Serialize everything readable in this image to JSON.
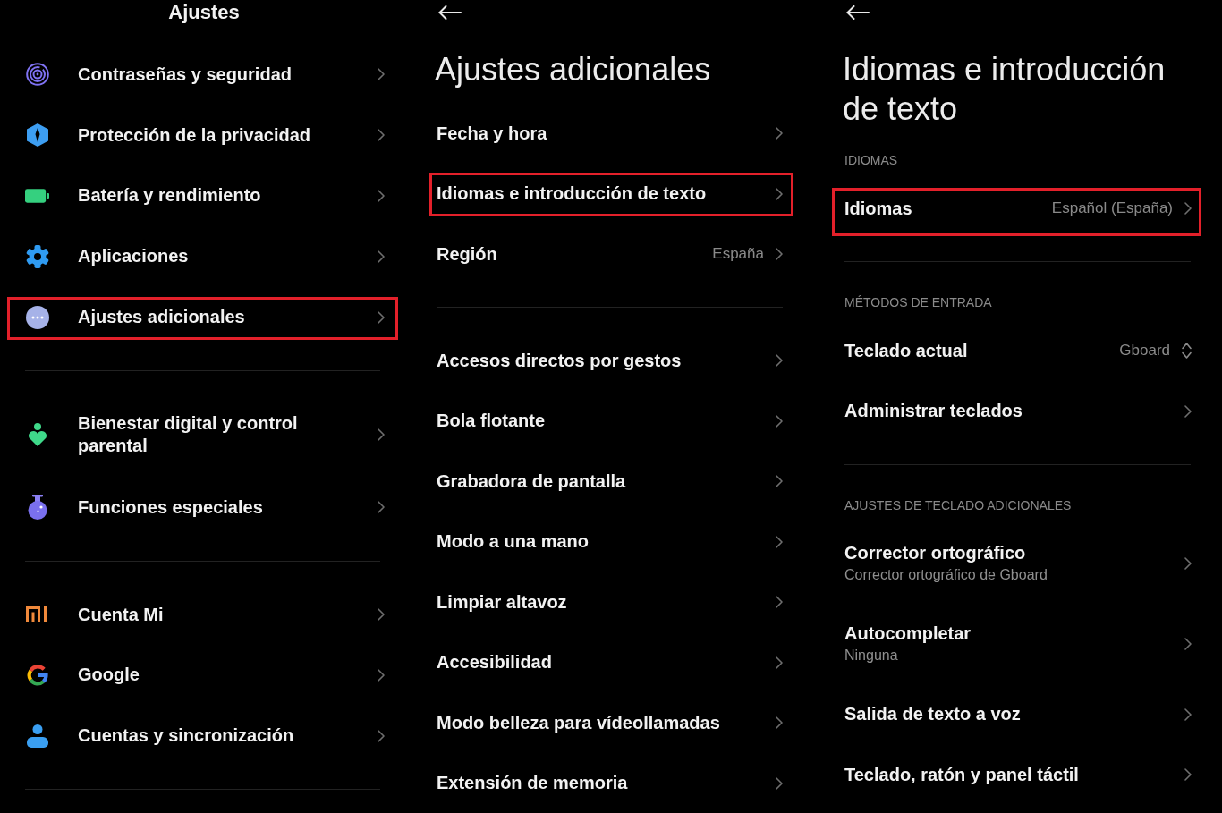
{
  "panels": [
    {
      "kind": "root",
      "title": "Ajustes",
      "groups": [
        {
          "items": [
            {
              "kind": "link",
              "label": "Contraseñas y seguridad",
              "highlighted": false
            },
            {
              "kind": "link",
              "label": "Protección de la privacidad",
              "highlighted": false
            },
            {
              "kind": "link",
              "label": "Batería y rendimiento",
              "highlighted": false
            },
            {
              "kind": "link",
              "label": "Aplicaciones",
              "highlighted": false
            },
            {
              "kind": "link",
              "label": "Ajustes adicionales",
              "highlighted": true
            }
          ]
        },
        {
          "items": [
            {
              "kind": "link",
              "label": "Bienestar digital y control parental",
              "highlighted": false
            },
            {
              "kind": "link",
              "label": "Funciones especiales",
              "highlighted": false
            }
          ]
        },
        {
          "items": [
            {
              "kind": "link",
              "label": "Cuenta Mi",
              "highlighted": false
            },
            {
              "kind": "link",
              "label": "Google",
              "highlighted": false
            },
            {
              "kind": "link",
              "label": "Cuentas y sincronización",
              "highlighted": false
            }
          ]
        }
      ]
    },
    {
      "kind": "sub",
      "title": "Ajustes adicionales",
      "groups": [
        {
          "items": [
            {
              "kind": "link",
              "label": "Fecha y hora",
              "highlighted": false
            },
            {
              "kind": "link",
              "label": "Idiomas e introducción de texto",
              "highlighted": true
            },
            {
              "kind": "link",
              "label": "Región",
              "value": "España",
              "highlighted": false
            }
          ]
        },
        {
          "items": [
            {
              "kind": "link",
              "label": "Accesos directos por gestos",
              "highlighted": false
            },
            {
              "kind": "link",
              "label": "Bola flotante",
              "highlighted": false
            },
            {
              "kind": "link",
              "label": "Grabadora de pantalla",
              "highlighted": false
            },
            {
              "kind": "link",
              "label": "Modo a una mano",
              "highlighted": false
            },
            {
              "kind": "link",
              "label": "Limpiar altavoz",
              "highlighted": false
            },
            {
              "kind": "link",
              "label": "Accesibilidad",
              "highlighted": false
            },
            {
              "kind": "link",
              "label": "Modo belleza para vídeollamadas",
              "highlighted": false
            },
            {
              "kind": "link",
              "label": "Extensión de memoria",
              "highlighted": false
            }
          ]
        }
      ]
    },
    {
      "kind": "sub",
      "title": "Idiomas e introducción de texto",
      "groups": [
        {
          "header": "IDIOMAS",
          "items": [
            {
              "kind": "link",
              "label": "Idiomas",
              "value": "Español (España)",
              "highlighted": true
            }
          ]
        },
        {
          "header": "MÉTODOS DE ENTRADA",
          "items": [
            {
              "kind": "select",
              "label": "Teclado actual",
              "value": "Gboard",
              "highlighted": false
            },
            {
              "kind": "link",
              "label": "Administrar teclados",
              "highlighted": false
            }
          ]
        },
        {
          "header": "AJUSTES DE TECLADO ADICIONALES",
          "items": [
            {
              "kind": "link",
              "label": "Corrector ortográfico",
              "subtitle": "Corrector ortográfico de Gboard",
              "highlighted": false
            },
            {
              "kind": "link",
              "label": "Autocompletar",
              "subtitle": "Ninguna",
              "highlighted": false
            },
            {
              "kind": "link",
              "label": "Salida de texto a voz",
              "highlighted": false
            },
            {
              "kind": "link",
              "label": "Teclado, ratón y panel táctil",
              "highlighted": false
            }
          ]
        }
      ]
    }
  ]
}
